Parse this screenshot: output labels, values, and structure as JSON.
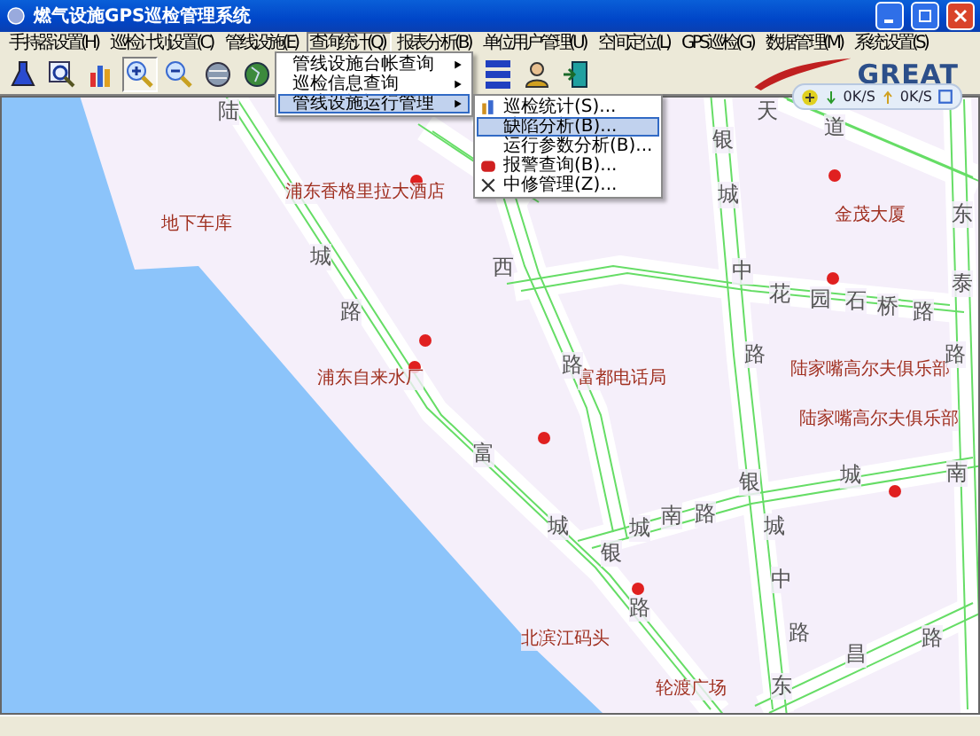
{
  "window": {
    "title": "燃气设施GPS巡检管理系统"
  },
  "menus": [
    {
      "label": "手持器设置(H)",
      "selected": false
    },
    {
      "label": "巡检计划设置(C)",
      "selected": false
    },
    {
      "label": "管线设施(E)",
      "selected": false
    },
    {
      "label": "查询统计(Q)",
      "selected": true
    },
    {
      "label": "报表分析(B)",
      "selected": false
    },
    {
      "label": "单位用户管理(U)",
      "selected": false
    },
    {
      "label": "空间定位(L)",
      "selected": false
    },
    {
      "label": "GPS巡检(G)",
      "selected": false
    },
    {
      "label": "数据管理(M)",
      "selected": false
    },
    {
      "label": "系统设置(S)",
      "selected": false
    }
  ],
  "toolbar": [
    {
      "pressed": false
    },
    {
      "pressed": false
    },
    {
      "pressed": false
    },
    {
      "pressed": true
    },
    {
      "pressed": false
    },
    {
      "pressed": false
    },
    {
      "pressed": false
    },
    {
      "pressed": false
    },
    {
      "pressed": false
    },
    {
      "pressed": false
    }
  ],
  "logo": "GREAT",
  "speed_panel": {
    "download": "0K/S",
    "upload": "0K/S"
  },
  "submenu": [
    {
      "label": "管线设施台帐查询",
      "selected": false,
      "has_children": true
    },
    {
      "label": "巡检信息查询",
      "selected": false,
      "has_children": true
    },
    {
      "label": "管线设施运行管理",
      "selected": true,
      "has_children": true
    }
  ],
  "subsubmenu": [
    {
      "label": "巡检统计(S)...",
      "selected": false
    },
    {
      "label": "缺陷分析(B)...",
      "selected": true
    },
    {
      "label": "运行参数分析(B)...",
      "selected": false
    },
    {
      "label": "报警查询(B)...",
      "selected": false
    },
    {
      "label": "中修管理(Z)...",
      "selected": false
    }
  ],
  "places": [
    "地下车库",
    "浦东香格里拉大酒店",
    "浦东自来水厂",
    "金茂大厦",
    "富都电话局",
    "陆家嘴高尔夫俱乐部",
    "陆家嘴高尔夫俱乐部",
    "北滨江码头",
    "轮渡广场"
  ],
  "road_labels": [
    "陆",
    "城",
    "路",
    "西",
    "路",
    "银",
    "城",
    "中",
    "路",
    "花",
    "园",
    "石",
    "桥",
    "路",
    "东",
    "泰",
    "路",
    "天",
    "道",
    "富",
    "城",
    "城",
    "银",
    "南",
    "路",
    "银",
    "城",
    "南",
    "城",
    "中",
    "路",
    "路",
    "昌",
    "路",
    "东"
  ]
}
